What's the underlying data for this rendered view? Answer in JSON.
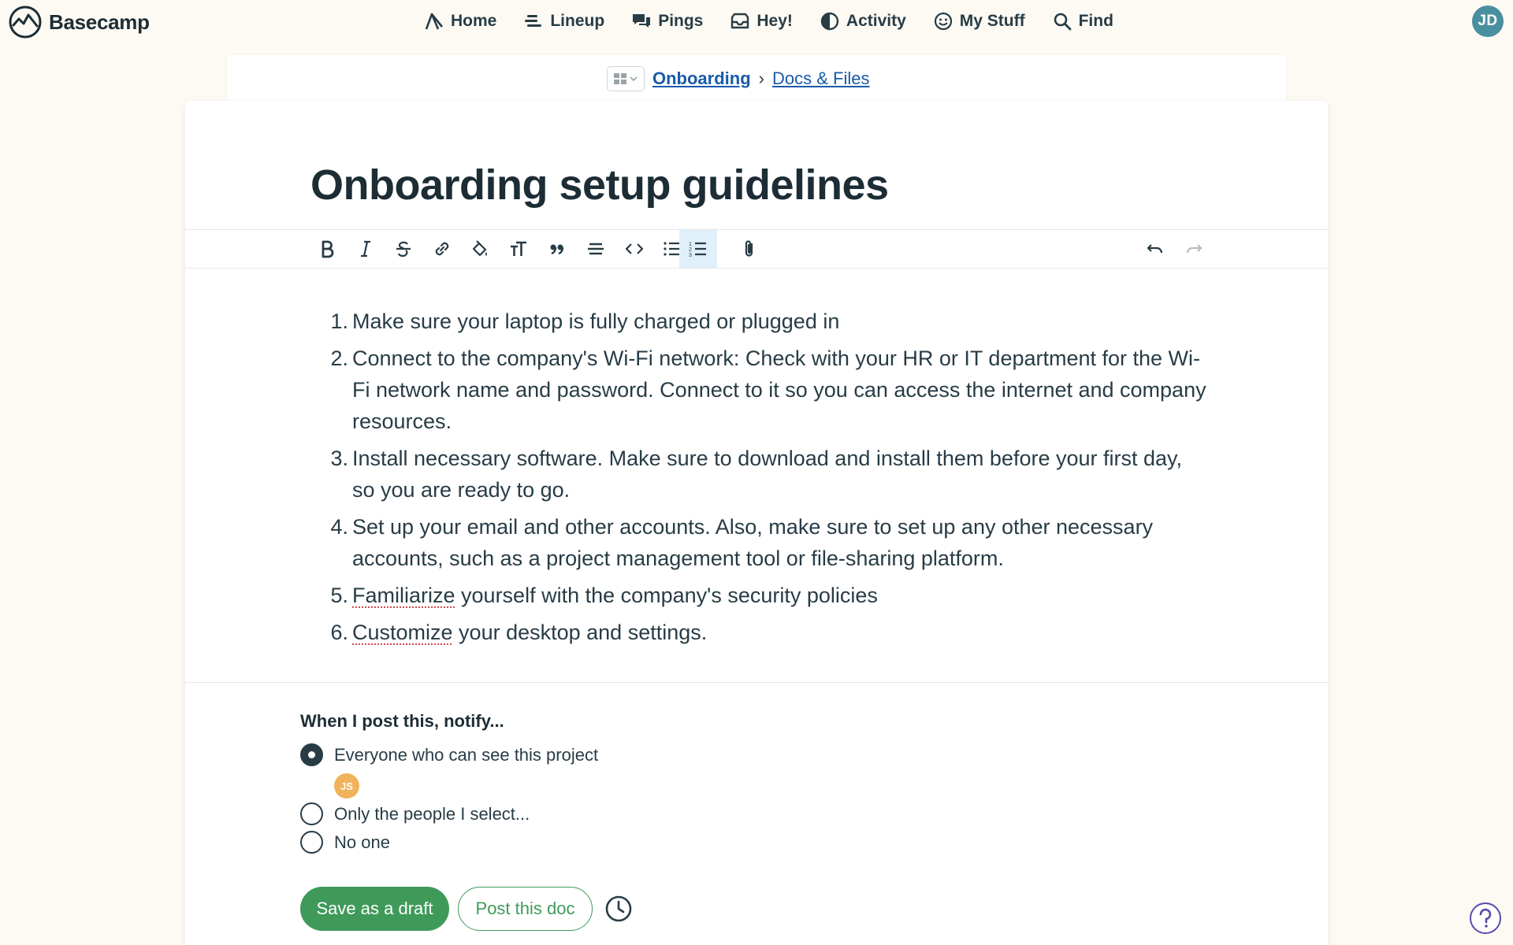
{
  "app": {
    "name": "Basecamp"
  },
  "nav": {
    "items": [
      {
        "label": "Home",
        "icon": "home-icon"
      },
      {
        "label": "Lineup",
        "icon": "lineup-icon"
      },
      {
        "label": "Pings",
        "icon": "pings-icon"
      },
      {
        "label": "Hey!",
        "icon": "inbox-icon"
      },
      {
        "label": "Activity",
        "icon": "activity-icon"
      },
      {
        "label": "My Stuff",
        "icon": "smiley-icon"
      },
      {
        "label": "Find",
        "icon": "search-icon"
      }
    ],
    "avatar_initials": "JD"
  },
  "breadcrumb": {
    "project": "Onboarding",
    "separator": "›",
    "section": "Docs & Files"
  },
  "document": {
    "title": "Onboarding setup guidelines",
    "list": [
      {
        "num": "1.",
        "text": "Make sure your laptop is fully charged or plugged in"
      },
      {
        "num": "2.",
        "text": "Connect to the company's Wi-Fi network: Check with your HR or IT department for the Wi-Fi network name and password. Connect to it so you can access the internet and company resources."
      },
      {
        "num": "3.",
        "text": "Install necessary software. Make sure to download and install them before your first day, so you are ready to go."
      },
      {
        "num": "4.",
        "text": "Set up your email and other accounts. Also, make sure to set up any other necessary accounts, such as a project management tool or file-sharing platform."
      },
      {
        "num": "5.",
        "spell": "Familiarize",
        "rest": " yourself with the company's security policies"
      },
      {
        "num": "6.",
        "spell": "Customize",
        "rest": " your desktop and settings."
      }
    ]
  },
  "toolbar": {
    "buttons": [
      "bold-icon",
      "italic-icon",
      "strikethrough-icon",
      "link-icon",
      "highlight-icon",
      "heading-icon",
      "quote-icon",
      "divider-icon",
      "code-icon",
      "bullet-list-icon",
      "numbered-list-icon",
      "attachment-icon",
      "undo-icon",
      "redo-icon"
    ],
    "active": "numbered-list-icon"
  },
  "notify": {
    "title": "When I post this, notify...",
    "options": [
      {
        "label": "Everyone who can see this project",
        "checked": true
      },
      {
        "label": "Only the people I select...",
        "checked": false
      },
      {
        "label": "No one",
        "checked": false
      }
    ],
    "avatar_initials": "JS"
  },
  "actions": {
    "draft_label": "Save as a draft",
    "post_label": "Post this doc"
  },
  "colors": {
    "accent_green": "#3f9a5a",
    "link_blue": "#1a5aa9",
    "text_dark": "#283c46",
    "background": "#fdfaf3"
  }
}
